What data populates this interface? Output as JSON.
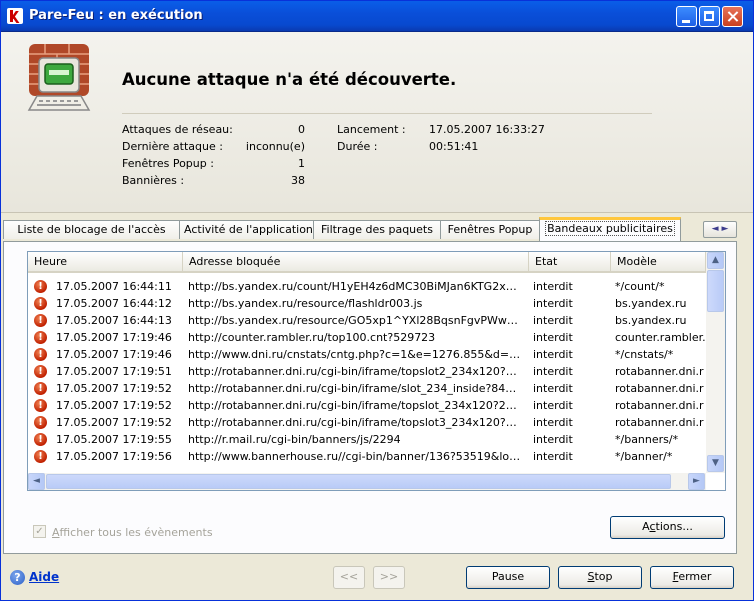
{
  "window": {
    "title": "Pare-Feu : en exécution",
    "colors": {
      "titlebar": "#0a4fd9",
      "accent_tab": "#ffc73c",
      "alert": "#c02000",
      "link": "#0033cc"
    }
  },
  "header": {
    "headline": "Aucune attaque n'a été découverte.",
    "stats": {
      "network_attacks_label": "Attaques de réseau:",
      "network_attacks_value": "0",
      "last_attack_label": "Dernière attaque :",
      "last_attack_value": "inconnu(e)",
      "popup_label": "Fenêtres Popup :",
      "popup_value": "1",
      "banners_label": "Bannières :",
      "banners_value": "38",
      "launch_label": "Lancement :",
      "launch_value": "17.05.2007 16:33:27",
      "duration_label": "Durée :",
      "duration_value": "00:51:41"
    }
  },
  "tabs": [
    {
      "label": "Liste de blocage de l'accès"
    },
    {
      "label": "Activité de l'application"
    },
    {
      "label": "Filtrage des paquets"
    },
    {
      "label": "Fenêtres Popup"
    },
    {
      "label": "Bandeaux publicitaires",
      "active": true
    }
  ],
  "tab_scroll": {
    "left": "◄",
    "right": "►"
  },
  "table": {
    "columns": [
      "Heure",
      "Adresse bloquée",
      "Etat",
      "Modèle"
    ],
    "rows": [
      [
        "17.05.2007 16:44:11",
        "http://bs.yandex.ru/count/H1yEH4z6dMC30BiMJan6KTG2x…",
        "interdit",
        "*/count/*"
      ],
      [
        "17.05.2007 16:44:12",
        "http://bs.yandex.ru/resource/flashldr003.js",
        "interdit",
        "bs.yandex.ru"
      ],
      [
        "17.05.2007 16:44:13",
        "http://bs.yandex.ru/resource/GO5xp1^YXl28BqsnFgvPWw…",
        "interdit",
        "bs.yandex.ru"
      ],
      [
        "17.05.2007 17:19:46",
        "http://counter.rambler.ru/top100.cnt?529723",
        "interdit",
        "counter.rambler."
      ],
      [
        "17.05.2007 17:19:46",
        "http://www.dni.ru/cnstats/cntg.php?c=1&e=1276.855&d=…",
        "interdit",
        "*/cnstats/*"
      ],
      [
        "17.05.2007 17:19:51",
        "http://rotabanner.dni.ru/cgi-bin/iframe/topslot2_234x120?…",
        "interdit",
        "rotabanner.dni.r"
      ],
      [
        "17.05.2007 17:19:52",
        "http://rotabanner.dni.ru/cgi-bin/iframe/slot_234_inside?84…",
        "interdit",
        "rotabanner.dni.r"
      ],
      [
        "17.05.2007 17:19:52",
        "http://rotabanner.dni.ru/cgi-bin/iframe/topslot_234x120?2…",
        "interdit",
        "rotabanner.dni.r"
      ],
      [
        "17.05.2007 17:19:52",
        "http://rotabanner.dni.ru/cgi-bin/iframe/topslot3_234x120?…",
        "interdit",
        "rotabanner.dni.r"
      ],
      [
        "17.05.2007 17:19:55",
        "http://r.mail.ru/cgi-bin/banners/js/2294",
        "interdit",
        "*/banners/*"
      ],
      [
        "17.05.2007 17:19:56",
        "http://www.bannerhouse.ru//cgi-bin/banner/136?53519&lo…",
        "interdit",
        "*/banner/*"
      ]
    ]
  },
  "buttons": {
    "actions_pre": "A",
    "actions_u": "c",
    "actions_post": "tions...",
    "prev": "<<",
    "next": ">>",
    "pause": "Pause",
    "stop_u": "S",
    "stop_post": "top",
    "close_u": "F",
    "close_post": "ermer"
  },
  "show_all": {
    "checked": true,
    "label_u": "A",
    "label_post": "fficher tous les évènements"
  },
  "help": {
    "label": "Aide"
  }
}
